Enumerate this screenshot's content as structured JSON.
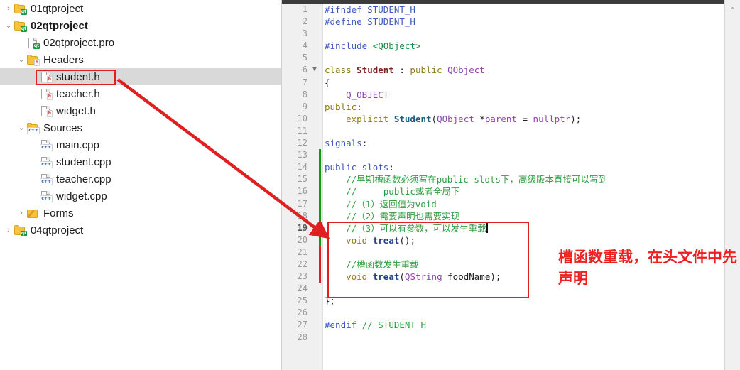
{
  "tree": {
    "name": "project-tree",
    "rows": [
      {
        "label": "01qtproject",
        "indent": 0,
        "twisty": "›",
        "icon": "qt-project-folder-icon",
        "bold": false,
        "selected": false
      },
      {
        "label": "02qtproject",
        "indent": 0,
        "twisty": "⌄",
        "icon": "qt-project-folder-icon",
        "bold": true,
        "selected": false
      },
      {
        "label": "02qtproject.pro",
        "indent": 1,
        "twisty": "",
        "icon": "qt-pro-file-icon",
        "bold": false,
        "selected": false
      },
      {
        "label": "Headers",
        "indent": 1,
        "twisty": "⌄",
        "icon": "headers-folder-icon",
        "bold": false,
        "selected": false
      },
      {
        "label": "student.h",
        "indent": 2,
        "twisty": "",
        "icon": "header-file-icon",
        "bold": false,
        "selected": true
      },
      {
        "label": "teacher.h",
        "indent": 2,
        "twisty": "",
        "icon": "header-file-icon",
        "bold": false,
        "selected": false
      },
      {
        "label": "widget.h",
        "indent": 2,
        "twisty": "",
        "icon": "header-file-icon",
        "bold": false,
        "selected": false
      },
      {
        "label": "Sources",
        "indent": 1,
        "twisty": "⌄",
        "icon": "sources-folder-icon",
        "bold": false,
        "selected": false
      },
      {
        "label": "main.cpp",
        "indent": 2,
        "twisty": "",
        "icon": "cpp-file-icon",
        "bold": false,
        "selected": false
      },
      {
        "label": "student.cpp",
        "indent": 2,
        "twisty": "",
        "icon": "cpp-file-icon",
        "bold": false,
        "selected": false
      },
      {
        "label": "teacher.cpp",
        "indent": 2,
        "twisty": "",
        "icon": "cpp-file-icon",
        "bold": false,
        "selected": false
      },
      {
        "label": "widget.cpp",
        "indent": 2,
        "twisty": "",
        "icon": "cpp-file-icon",
        "bold": false,
        "selected": false
      },
      {
        "label": "Forms",
        "indent": 1,
        "twisty": "›",
        "icon": "forms-folder-icon",
        "bold": false,
        "selected": false
      },
      {
        "label": "04qtproject",
        "indent": 0,
        "twisty": "›",
        "icon": "qt-project-folder-icon",
        "bold": false,
        "selected": false
      }
    ]
  },
  "editor": {
    "name": "student-h-code-editor",
    "current_line": 19,
    "lines": [
      {
        "n": 1,
        "fold": "",
        "tokens": [
          {
            "t": "#ifndef ",
            "c": "k-pre"
          },
          {
            "t": "STUDENT_H",
            "c": "k-pre"
          }
        ]
      },
      {
        "n": 2,
        "fold": "",
        "tokens": [
          {
            "t": "#define ",
            "c": "k-pre"
          },
          {
            "t": "STUDENT_H",
            "c": "k-pre"
          }
        ]
      },
      {
        "n": 3,
        "fold": "",
        "tokens": []
      },
      {
        "n": 4,
        "fold": "",
        "tokens": [
          {
            "t": "#include ",
            "c": "k-pre"
          },
          {
            "t": "<QObject>",
            "c": "k-hdr"
          }
        ]
      },
      {
        "n": 5,
        "fold": "",
        "tokens": []
      },
      {
        "n": 6,
        "fold": "▼",
        "tokens": [
          {
            "t": "class ",
            "c": "k-kw"
          },
          {
            "t": "Student",
            "c": "k-type"
          },
          {
            "t": " : ",
            "c": "k-plain"
          },
          {
            "t": "public",
            "c": "k-kw"
          },
          {
            "t": " ",
            "c": "k-plain"
          },
          {
            "t": "QObject",
            "c": "k-cls"
          }
        ]
      },
      {
        "n": 7,
        "fold": "",
        "tokens": [
          {
            "t": "{",
            "c": "k-plain"
          }
        ]
      },
      {
        "n": 8,
        "fold": "",
        "tokens": [
          {
            "t": "    ",
            "c": "k-plain"
          },
          {
            "t": "Q_OBJECT",
            "c": "k-macro"
          }
        ]
      },
      {
        "n": 9,
        "fold": "",
        "tokens": [
          {
            "t": "public",
            "c": "k-kw"
          },
          {
            "t": ":",
            "c": "k-plain"
          }
        ]
      },
      {
        "n": 10,
        "fold": "",
        "tokens": [
          {
            "t": "    ",
            "c": "k-plain"
          },
          {
            "t": "explicit ",
            "c": "k-kw"
          },
          {
            "t": "Student",
            "c": "k-fn"
          },
          {
            "t": "(",
            "c": "k-plain"
          },
          {
            "t": "QObject ",
            "c": "k-cls"
          },
          {
            "t": "*",
            "c": "k-plain"
          },
          {
            "t": "parent",
            "c": "k-cls"
          },
          {
            "t": " = ",
            "c": "k-plain"
          },
          {
            "t": "nullptr",
            "c": "k-cls"
          },
          {
            "t": ");",
            "c": "k-plain"
          }
        ]
      },
      {
        "n": 11,
        "fold": "",
        "tokens": []
      },
      {
        "n": 12,
        "fold": "",
        "tokens": [
          {
            "t": "signals",
            "c": "k-label"
          },
          {
            "t": ":",
            "c": "k-plain"
          }
        ]
      },
      {
        "n": 13,
        "fold": "",
        "tokens": []
      },
      {
        "n": 14,
        "fold": "",
        "tokens": [
          {
            "t": "public slots",
            "c": "k-label"
          },
          {
            "t": ":",
            "c": "k-plain"
          }
        ]
      },
      {
        "n": 15,
        "fold": "",
        "tokens": [
          {
            "t": "    //早期槽函数必须写在public slots下，高级版本直接可以写到",
            "c": "k-cmt"
          }
        ]
      },
      {
        "n": 16,
        "fold": "",
        "tokens": [
          {
            "t": "    //     public或者全局下",
            "c": "k-cmt"
          }
        ]
      },
      {
        "n": 17,
        "fold": "",
        "tokens": [
          {
            "t": "    //（1）返回值为void",
            "c": "k-cmt"
          }
        ]
      },
      {
        "n": 18,
        "fold": "",
        "tokens": [
          {
            "t": "    //（2）需要声明也需要实现",
            "c": "k-cmt"
          }
        ]
      },
      {
        "n": 19,
        "fold": "",
        "tokens": [
          {
            "t": "    //（3）可以有参数，可以发生重载",
            "c": "k-cmt"
          }
        ],
        "caret": true
      },
      {
        "n": 20,
        "fold": "",
        "tokens": [
          {
            "t": "    ",
            "c": "k-plain"
          },
          {
            "t": "void ",
            "c": "k-kw"
          },
          {
            "t": "treat",
            "c": "k-fn2"
          },
          {
            "t": "();",
            "c": "k-plain"
          }
        ]
      },
      {
        "n": 21,
        "fold": "",
        "tokens": []
      },
      {
        "n": 22,
        "fold": "",
        "tokens": [
          {
            "t": "    //槽函数发生重载",
            "c": "k-cmt"
          }
        ]
      },
      {
        "n": 23,
        "fold": "",
        "tokens": [
          {
            "t": "    ",
            "c": "k-plain"
          },
          {
            "t": "void ",
            "c": "k-kw"
          },
          {
            "t": "treat",
            "c": "k-fn2"
          },
          {
            "t": "(",
            "c": "k-plain"
          },
          {
            "t": "QString ",
            "c": "k-cls"
          },
          {
            "t": "foodName",
            "c": "k-plain"
          },
          {
            "t": ");",
            "c": "k-plain"
          }
        ]
      },
      {
        "n": 24,
        "fold": "",
        "tokens": []
      },
      {
        "n": 25,
        "fold": "",
        "tokens": [
          {
            "t": "};",
            "c": "k-plain"
          }
        ]
      },
      {
        "n": 26,
        "fold": "",
        "tokens": []
      },
      {
        "n": 27,
        "fold": "",
        "tokens": [
          {
            "t": "#endif ",
            "c": "k-pre"
          },
          {
            "t": "// STUDENT_H",
            "c": "k-cmt"
          }
        ]
      },
      {
        "n": 28,
        "fold": "",
        "tokens": []
      }
    ]
  },
  "annotation": {
    "name": "overload-note",
    "text": "槽函数重载，在头文件中先声明",
    "color": "#ef2020"
  },
  "scrollbar": {
    "up_arrow": "⌃"
  },
  "colors": {
    "selection": "#d9d9d9",
    "highlight_box": "#e02020",
    "change_added": "#0a9a0a",
    "change_modified": "#e02020",
    "gutter_bg": "#f0f0f0"
  }
}
